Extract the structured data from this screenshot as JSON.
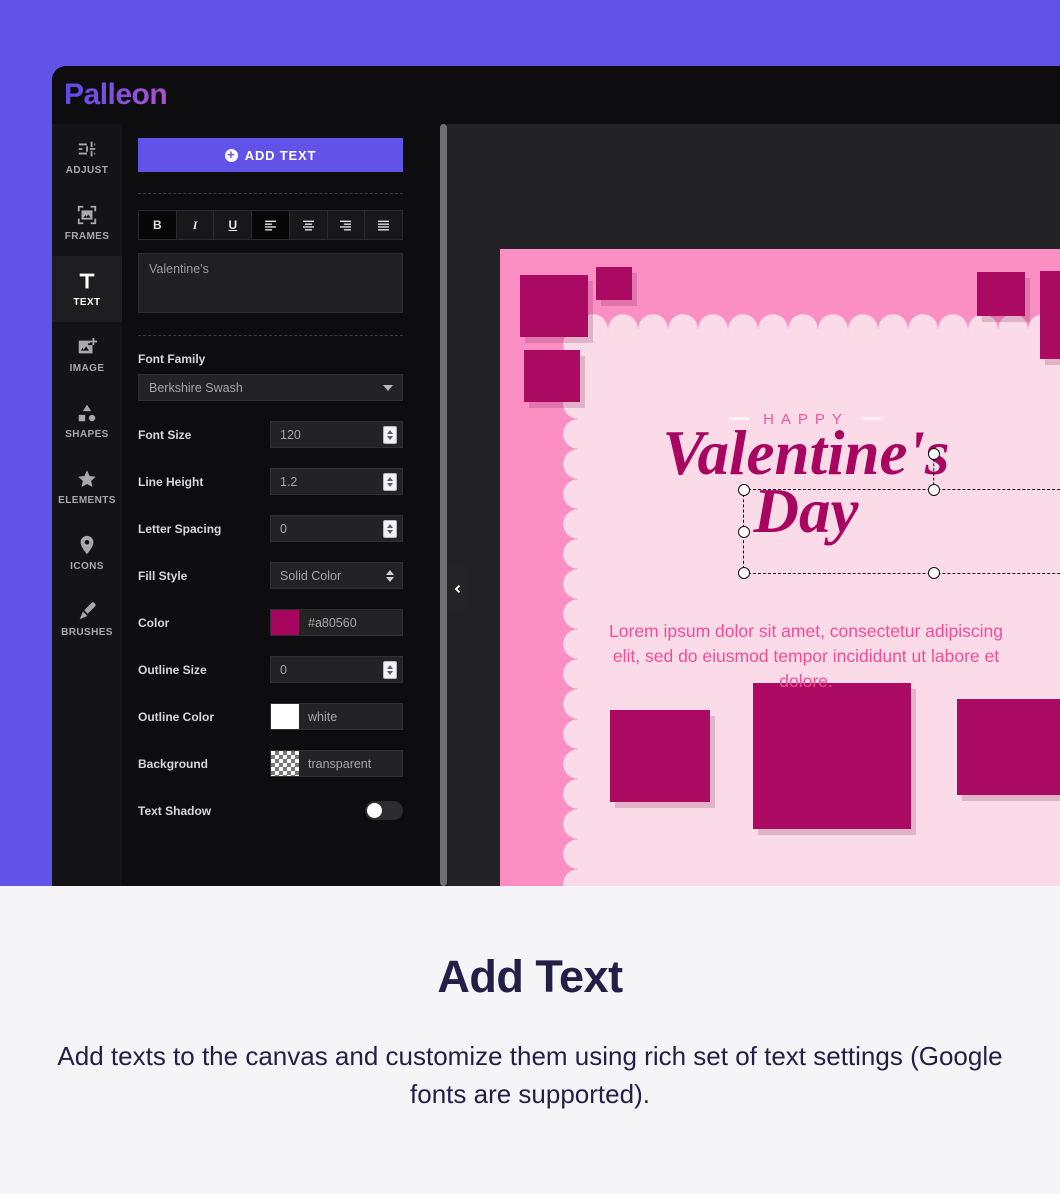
{
  "app": {
    "logo": "Palleon"
  },
  "sidebar": {
    "items": [
      {
        "label": "ADJUST",
        "icon": "sliders-icon"
      },
      {
        "label": "FRAMES",
        "icon": "frame-icon"
      },
      {
        "label": "TEXT",
        "icon": "text-t-icon"
      },
      {
        "label": "IMAGE",
        "icon": "image-plus-icon"
      },
      {
        "label": "SHAPES",
        "icon": "shapes-icon"
      },
      {
        "label": "ELEMENTS",
        "icon": "star-icon"
      },
      {
        "label": "ICONS",
        "icon": "map-pin-icon"
      },
      {
        "label": "BRUSHES",
        "icon": "brush-icon"
      }
    ],
    "active_index": 2
  },
  "panel": {
    "add_text_button": "ADD TEXT",
    "format_buttons": [
      {
        "name": "bold",
        "label": "B",
        "active": true
      },
      {
        "name": "italic",
        "label": "I",
        "active": false
      },
      {
        "name": "underline",
        "label": "U",
        "active": false
      },
      {
        "name": "align-left",
        "label": "",
        "active": true
      },
      {
        "name": "align-center",
        "label": "",
        "active": false
      },
      {
        "name": "align-right",
        "label": "",
        "active": false
      },
      {
        "name": "align-justify",
        "label": "",
        "active": false
      }
    ],
    "text_value": "Valentine's",
    "fields": {
      "font_family_label": "Font Family",
      "font_family_value": "Berkshire Swash",
      "font_size_label": "Font Size",
      "font_size_value": "120",
      "line_height_label": "Line Height",
      "line_height_value": "1.2",
      "letter_spacing_label": "Letter Spacing",
      "letter_spacing_value": "0",
      "fill_style_label": "Fill Style",
      "fill_style_value": "Solid Color",
      "color_label": "Color",
      "color_value": "#a80560",
      "outline_size_label": "Outline Size",
      "outline_size_value": "0",
      "outline_color_label": "Outline Color",
      "outline_color_value": "white",
      "background_label": "Background",
      "background_value": "transparent",
      "text_shadow_label": "Text Shadow",
      "text_shadow_on": false
    }
  },
  "canvas": {
    "eyebrow": "HAPPY",
    "headline_line1": "Valentine's",
    "headline_line2": "Day",
    "body": "Lorem ipsum dolor sit amet, consectetur adipiscing elit, sed do eiusmod tempor incididunt ut labore et dolore."
  },
  "caption": {
    "title": "Add Text",
    "description": "Add texts to the canvas and customize them using rich set of text settings (Google fonts are supported)."
  },
  "colors": {
    "brand_purple": "#6152e8",
    "text_color": "#a80560",
    "card_pink": "#fb8fc4",
    "card_inner_pink": "#fcdbe9",
    "heart_magenta": "#ab0a63",
    "caption_navy": "#231f47"
  }
}
